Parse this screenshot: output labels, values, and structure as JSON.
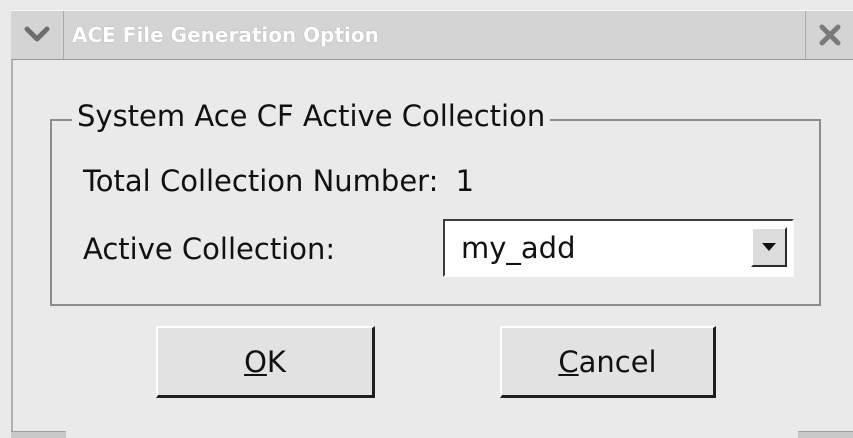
{
  "window": {
    "title": "ACE File Generation Option",
    "menu_icon": "chevron-down-icon",
    "close_icon": "close-icon"
  },
  "group": {
    "legend": "System Ace CF Active Collection",
    "total_label": "Total Collection Number:",
    "total_value": "1",
    "active_label": "Active Collection:",
    "active_value": "my_add",
    "dropdown_icon": "dropdown-arrow-icon"
  },
  "buttons": {
    "ok_mnemonic": "O",
    "ok_rest": "K",
    "cancel_mnemonic": "C",
    "cancel_rest": "ancel"
  },
  "colors": {
    "window_bg": "#eaeaea",
    "titlebar_bg": "#d4d4d4",
    "title_text": "#ffffff"
  }
}
